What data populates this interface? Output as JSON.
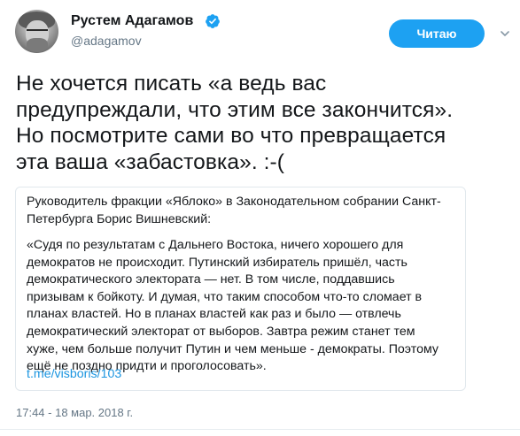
{
  "user": {
    "name": "Рустем Адагамов",
    "handle": "@adagamov"
  },
  "follow_button": {
    "label": "Читаю"
  },
  "tweet": {
    "lines": [
      "Не хочется писать «а ведь вас",
      "предупреждали, что этим все закончится».",
      "Но посмотрите сами во что превращается",
      "эта ваша «забастовка». :-("
    ]
  },
  "quote": {
    "intro_lines": [
      "Руководитель фракции «Яблоко» в Законодательном собрании Санкт-",
      "Петербурга Борис Вишневский:"
    ],
    "body_lines": [
      "«Судя по результатам с Дальнего Востока, ничего хорошего для",
      "демократов не происходит. Путинский избиратель пришёл, часть",
      "демократического электората — нет. В том числе, поддавшись",
      "призывам к бойкоту. И думая, что таким способом что-то сломает в",
      "планах властей. Но в планах властей как раз и было — отвлечь",
      "демократический электорат от выборов. Завтра режим станет тем",
      "хуже, чем больше получит Путин и чем меньше - демократы. Поэтому",
      "ещё не поздно придти и проголосовать»."
    ],
    "link": "t.me/visboris/103"
  },
  "timestamp": "17:44 - 18 мар. 2018 г.",
  "colors": {
    "accent": "#1da1f2",
    "link": "#1b95e0",
    "secondary_text": "#657786"
  },
  "icons": {
    "verified": "verified-badge-icon",
    "menu": "chevron-down-icon"
  }
}
